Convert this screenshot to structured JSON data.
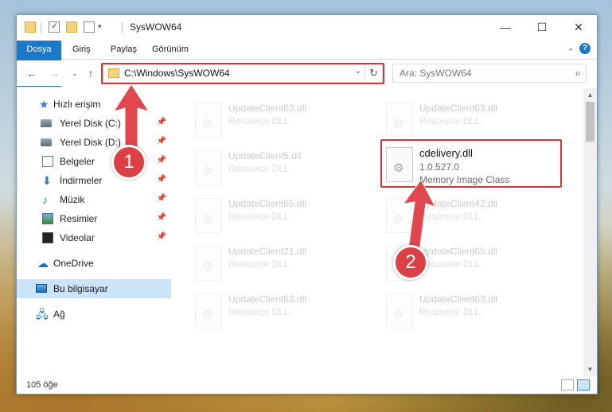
{
  "window": {
    "title": "SysWOW64",
    "controls": {
      "minimize": "—",
      "maximize": "☐",
      "close": "✕"
    }
  },
  "ribbon": {
    "tabs": [
      "Dosya",
      "Giriş",
      "Paylaş",
      "Görünüm"
    ]
  },
  "nav": {
    "address": "C:\\Windows\\SysWOW64",
    "search_placeholder": "Ara: SysWOW64"
  },
  "sidebar": {
    "items": [
      {
        "label": "Hızlı erişim",
        "icon": "star-icon",
        "pinned": false
      },
      {
        "label": "Yerel Disk (C:)",
        "icon": "drive-icon",
        "pinned": true
      },
      {
        "label": "Yerel Disk (D:)",
        "icon": "drive-icon",
        "pinned": true
      },
      {
        "label": "Belgeler",
        "icon": "documents-icon",
        "pinned": true
      },
      {
        "label": "İndirmeler",
        "icon": "download-icon",
        "pinned": true
      },
      {
        "label": "Müzik",
        "icon": "music-icon",
        "pinned": true
      },
      {
        "label": "Resimler",
        "icon": "pictures-icon",
        "pinned": true
      },
      {
        "label": "Videolar",
        "icon": "video-icon",
        "pinned": true
      },
      {
        "label": "OneDrive",
        "icon": "onedrive-icon",
        "pinned": false
      },
      {
        "label": "Bu bilgisayar",
        "icon": "computer-icon",
        "pinned": false,
        "selected": true
      },
      {
        "label": "Ağ",
        "icon": "network-icon",
        "pinned": false
      }
    ]
  },
  "files": {
    "col1": [
      {
        "name": "UpdateClient63.dll",
        "type": "Resource DLL"
      },
      {
        "name": "UpdateClient5.dll",
        "type": "Resource DLL"
      },
      {
        "name": "UpdateClient65.dll",
        "type": "Resource DLL"
      },
      {
        "name": "UpdateClient21.dll",
        "type": "Resource DLL"
      },
      {
        "name": "UpdateClient63.dll",
        "type": "Resource DLL"
      }
    ],
    "col2": [
      {
        "name": "UpdateClient63.dll",
        "type": "Resource DLL"
      },
      {
        "name": "UpdateClient42.dll",
        "type": "Resource DLL"
      },
      {
        "name": "UpdateClient65.dll",
        "type": "Resource DLL"
      },
      {
        "name": "UpdateClient63.dll",
        "type": "Resource DLL"
      }
    ],
    "highlighted": {
      "name": "cdelivery.dll",
      "version": "1.0.527.0",
      "description": "Memory Image Class"
    }
  },
  "status": {
    "item_count": "105 öğe"
  },
  "callouts": {
    "step1": "1",
    "step2": "2"
  },
  "colors": {
    "accent": "#1979ca",
    "highlight": "#d9343a",
    "selection": "#cce4f7"
  }
}
